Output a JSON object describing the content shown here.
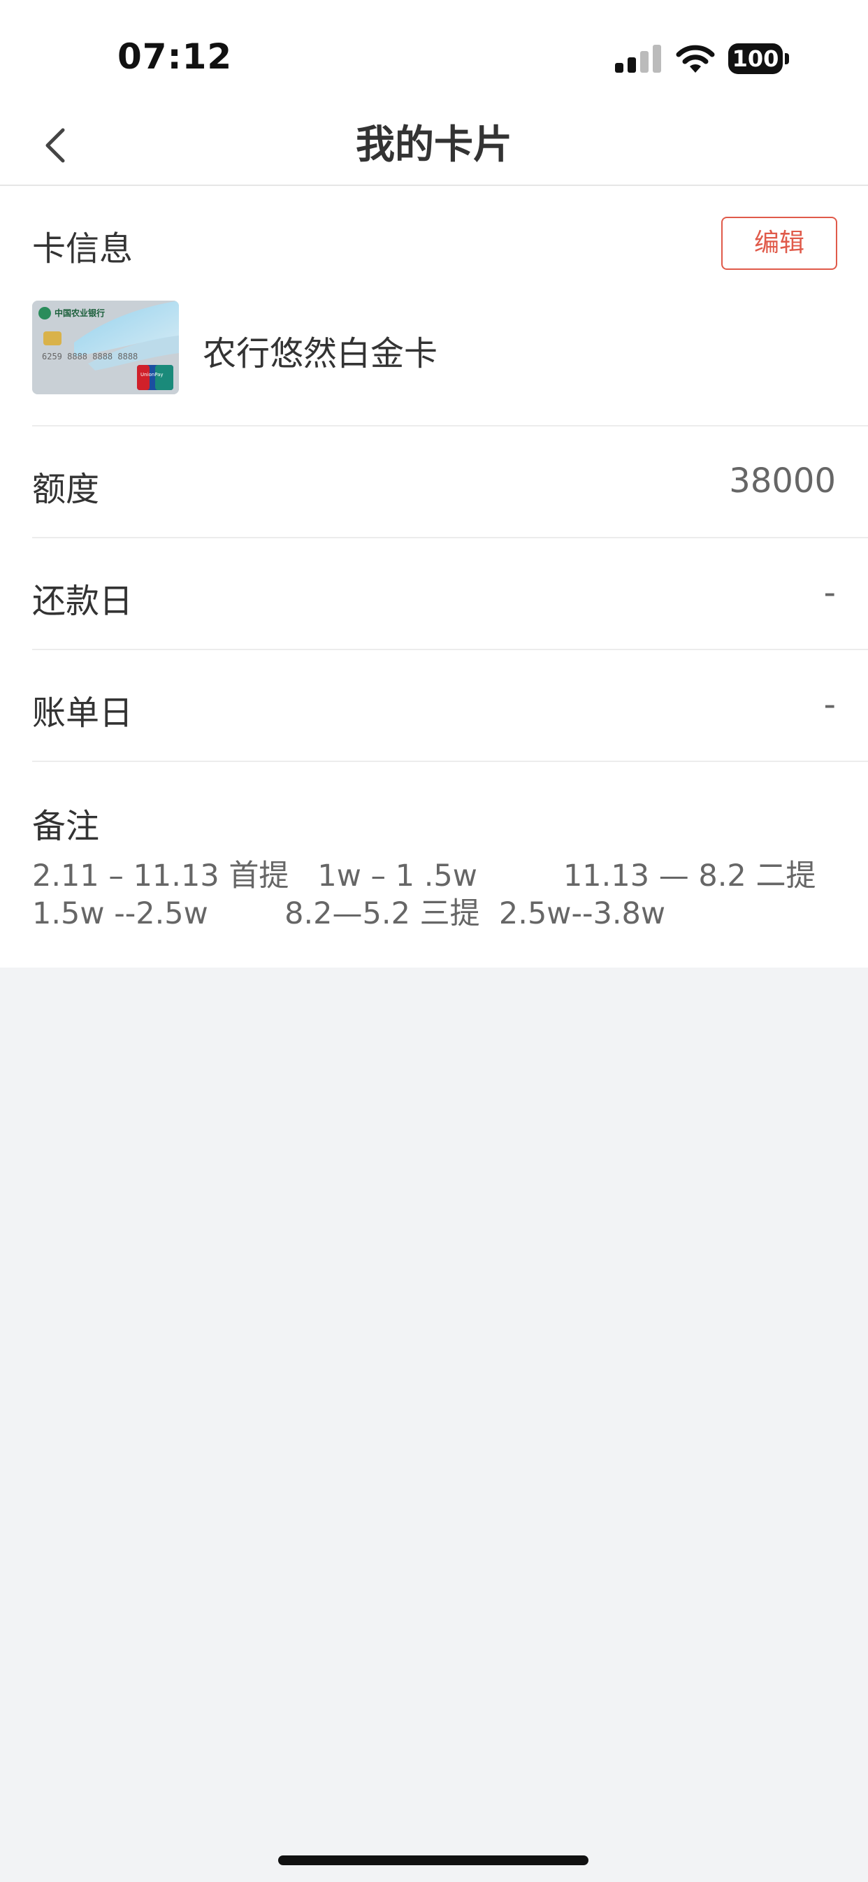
{
  "status_bar": {
    "time": "07:12",
    "battery": "100",
    "icons": [
      "signal-icon",
      "wifi-icon",
      "battery-icon"
    ]
  },
  "nav": {
    "title": "我的卡片",
    "back_icon": "chevron-left-icon"
  },
  "card_info": {
    "section_title": "卡信息",
    "edit_label": "编辑",
    "card_name": "农行悠然白金卡",
    "card_image_text": {
      "bank": "中国农业银行",
      "number": "6259 8888 8888 8888",
      "brand": "UnionPay"
    }
  },
  "fields": [
    {
      "label": "额度",
      "value": "38000"
    },
    {
      "label": "还款日",
      "value": "-"
    },
    {
      "label": "账单日",
      "value": "-"
    }
  ],
  "note": {
    "title": "备注",
    "text": "2.11 – 11.13 首提   1w – 1 .5w         11.13 — 8.2 二提\n1.5w --2.5w        8.2—5.2 三提  2.5w--3.8w"
  },
  "colors": {
    "accent": "#e05a4a",
    "background": "#f2f3f5",
    "surface": "#ffffff"
  }
}
